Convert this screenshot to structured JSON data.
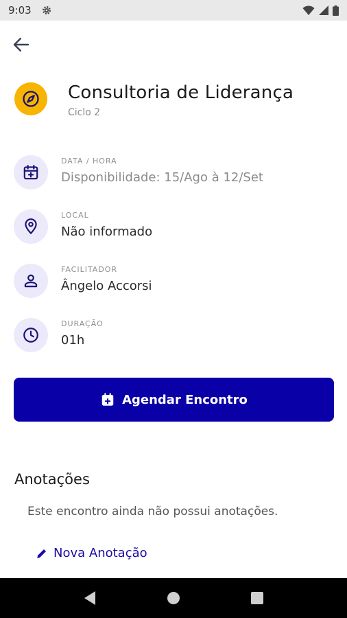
{
  "status_bar": {
    "time": "9:03",
    "icons": [
      "settings-icon",
      "wifi-icon",
      "signal-icon",
      "battery-icon"
    ]
  },
  "header": {
    "back_icon": "arrow-left-icon",
    "icon": "compass-icon",
    "icon_color": "#f7b400",
    "title": "Consultoria de Liderança",
    "subtitle": "Ciclo 2"
  },
  "details": [
    {
      "icon": "calendar-plus-icon",
      "label": "DATA / HORA",
      "value": "Disponibilidade: 15/Ago à 12/Set"
    },
    {
      "icon": "location-pin-icon",
      "label": "LOCAL",
      "value": "Não informado"
    },
    {
      "icon": "person-icon",
      "label": "FACILITADOR",
      "value": "Ângelo Accorsi"
    },
    {
      "icon": "clock-icon",
      "label": "DURAÇÃO",
      "value": "01h"
    }
  ],
  "schedule_button": {
    "icon": "calendar-plus-icon",
    "label": "Agendar Encontro",
    "color": "#0a00a8"
  },
  "notes": {
    "title": "Anotações",
    "empty_text": "Este encontro ainda não possui anotações.",
    "new_note_icon": "pencil-icon",
    "new_note_label": "Nova Anotação"
  },
  "nav_bar": {
    "buttons": [
      "back-triangle-icon",
      "home-circle-icon",
      "recents-square-icon"
    ]
  },
  "colors": {
    "accent": "#0a00a8",
    "icon_bg": "#ece9fb",
    "icon_fg": "#1a1470"
  }
}
